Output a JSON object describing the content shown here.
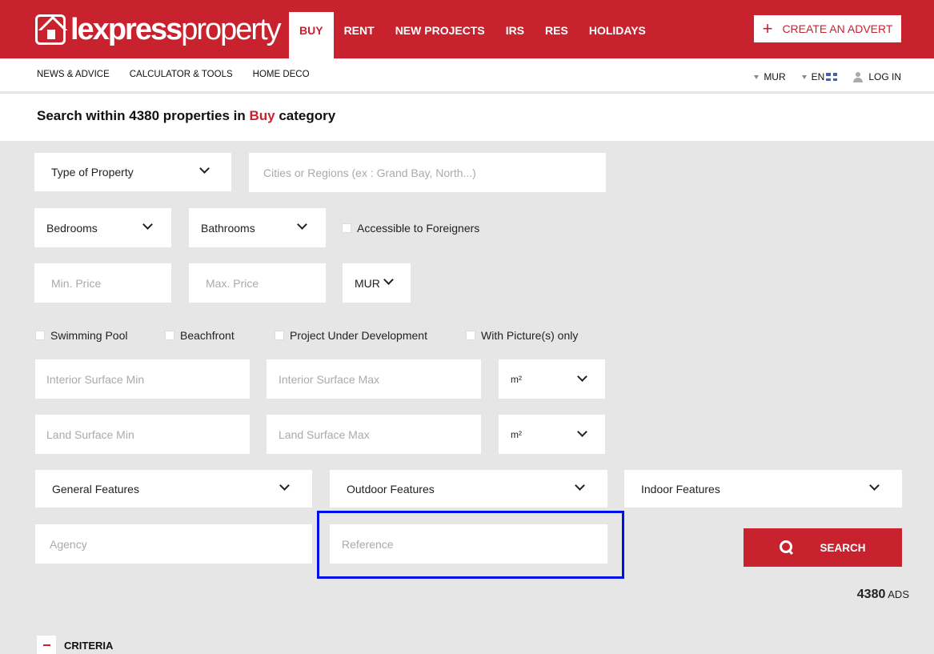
{
  "header": {
    "logo": {
      "bold": "lexpress",
      "light": "property"
    },
    "nav": [
      "BUY",
      "RENT",
      "NEW PROJECTS",
      "IRS",
      "RES",
      "HOLIDAYS"
    ],
    "create_advert": "CREATE AN ADVERT"
  },
  "subnav": {
    "links": [
      "NEWS & ADVICE",
      "CALCULATOR & TOOLS",
      "HOME DECO"
    ],
    "currency": "MUR",
    "language": "EN",
    "login": "LOG IN"
  },
  "search": {
    "heading_prefix": "Search within 4380 properties in ",
    "heading_category": "Buy",
    "heading_suffix": " category",
    "type_of_property": "Type of Property",
    "cities_placeholder": "Cities or Regions (ex : Grand Bay, North...)",
    "bedrooms": "Bedrooms",
    "bathrooms": "Bathrooms",
    "accessible_foreigners": "Accessible to Foreigners",
    "min_price_placeholder": "Min. Price",
    "max_price_placeholder": "Max. Price",
    "price_currency": "MUR",
    "swimming_pool": "Swimming Pool",
    "beachfront": "Beachfront",
    "project_under_development": "Project Under Development",
    "with_pictures": "With Picture(s) only",
    "interior_min_placeholder": "Interior Surface Min",
    "interior_max_placeholder": "Interior Surface Max",
    "interior_unit": "m²",
    "land_min_placeholder": "Land Surface Min",
    "land_max_placeholder": "Land Surface Max",
    "land_unit": "m²",
    "general_features": "General Features",
    "outdoor_features": "Outdoor Features",
    "indoor_features": "Indoor Features",
    "agency_placeholder": "Agency",
    "reference_placeholder": "Reference",
    "search_button": "SEARCH",
    "ads_count": "4380",
    "ads_label": "ADS",
    "criteria": "CRITERIA"
  }
}
